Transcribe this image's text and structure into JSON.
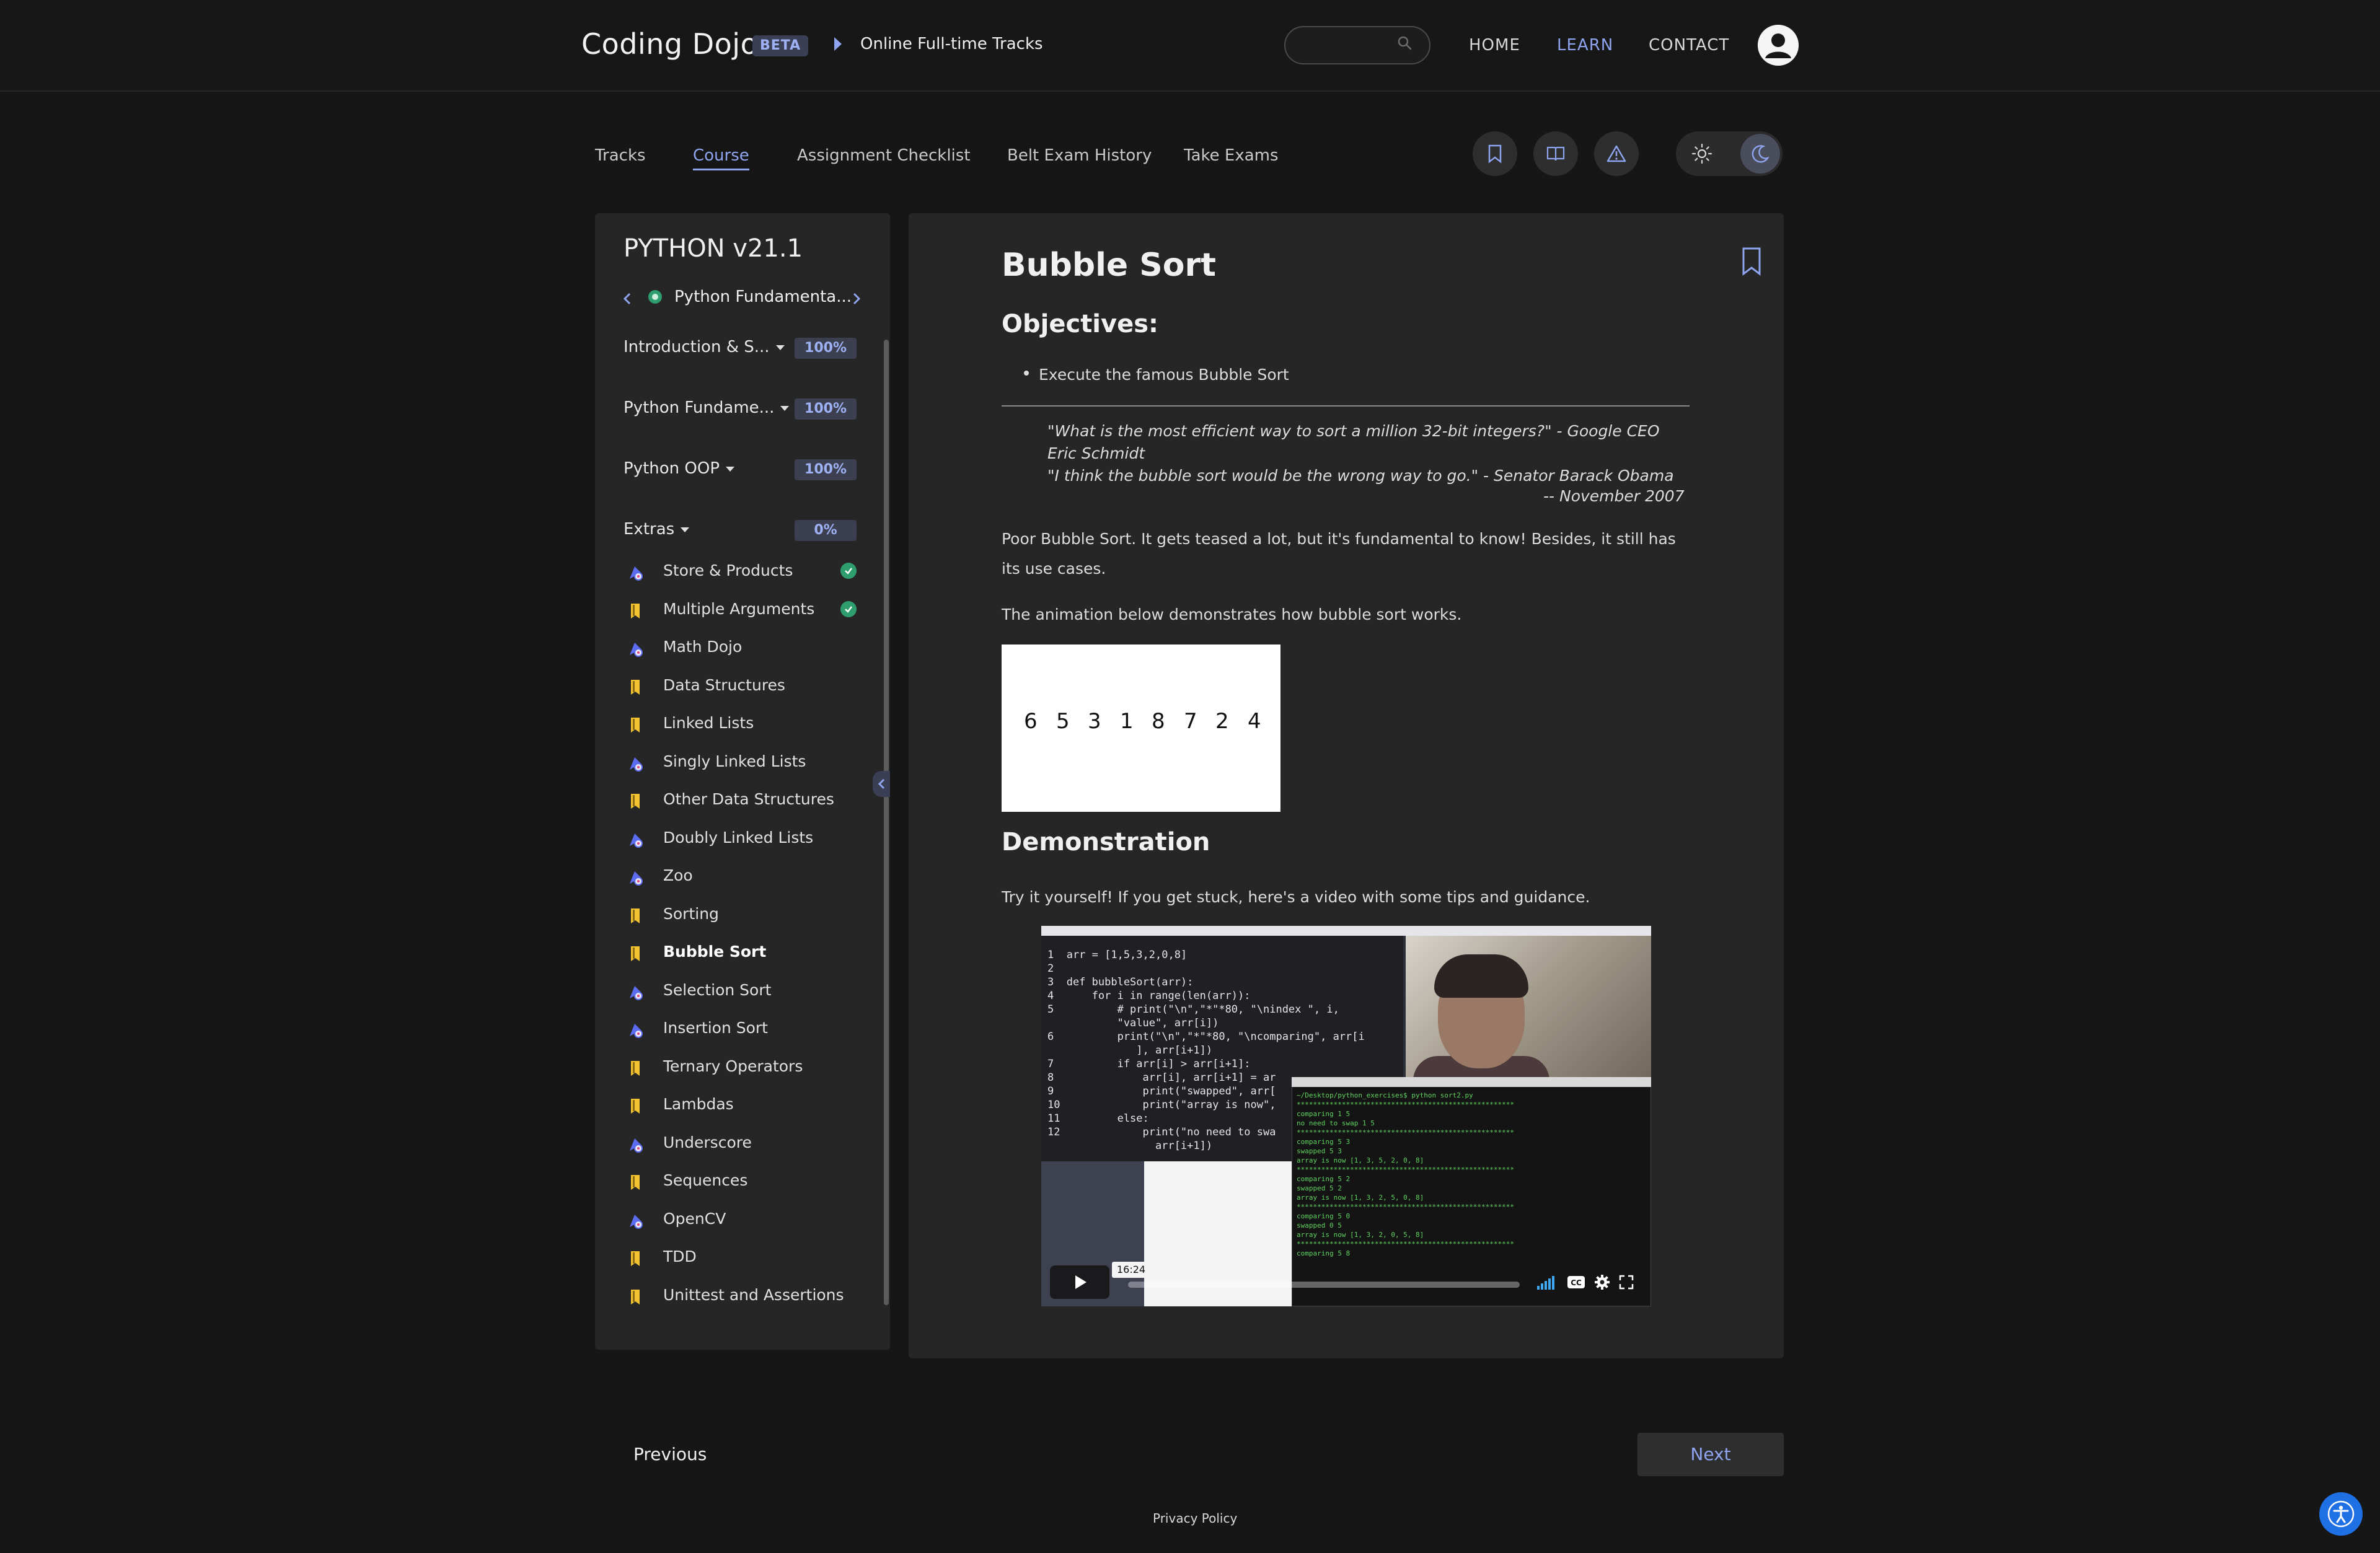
{
  "header": {
    "brand": "Coding Dojo",
    "badge": "BETA",
    "breadcrumb": "Online Full-time Tracks",
    "search_placeholder": "",
    "nav": {
      "home": "HOME",
      "learn": "LEARN",
      "contact": "CONTACT"
    }
  },
  "tabs": [
    {
      "label": "Tracks"
    },
    {
      "label": "Course"
    },
    {
      "label": "Assignment Checklist"
    },
    {
      "label": "Belt Exam History"
    },
    {
      "label": "Take Exams"
    }
  ],
  "sidebar": {
    "title": "PYTHON v21.1",
    "module": "Python Fundamenta...",
    "sections": [
      {
        "label": "Introduction & S...",
        "percent": "100%"
      },
      {
        "label": "Python Fundame...",
        "percent": "100%"
      },
      {
        "label": "Python OOP",
        "percent": "100%"
      },
      {
        "label": "Extras",
        "percent": "0%"
      }
    ],
    "items": [
      {
        "label": "Store & Products",
        "type": "assignment",
        "completed": true
      },
      {
        "label": "Multiple Arguments",
        "type": "reading",
        "completed": true
      },
      {
        "label": "Math Dojo",
        "type": "assignment",
        "completed": false
      },
      {
        "label": "Data Structures",
        "type": "reading",
        "completed": false
      },
      {
        "label": "Linked Lists",
        "type": "reading",
        "completed": false
      },
      {
        "label": "Singly Linked Lists",
        "type": "assignment",
        "completed": false
      },
      {
        "label": "Other Data Structures",
        "type": "reading",
        "completed": false
      },
      {
        "label": "Doubly Linked Lists",
        "type": "assignment",
        "completed": false
      },
      {
        "label": "Zoo",
        "type": "assignment",
        "completed": false
      },
      {
        "label": "Sorting",
        "type": "reading",
        "completed": false
      },
      {
        "label": "Bubble Sort",
        "type": "reading",
        "completed": false
      },
      {
        "label": "Selection Sort",
        "type": "assignment",
        "completed": false
      },
      {
        "label": "Insertion Sort",
        "type": "assignment",
        "completed": false
      },
      {
        "label": "Ternary Operators",
        "type": "reading",
        "completed": false
      },
      {
        "label": "Lambdas",
        "type": "reading",
        "completed": false
      },
      {
        "label": "Underscore",
        "type": "assignment",
        "completed": false
      },
      {
        "label": "Sequences",
        "type": "reading",
        "completed": false
      },
      {
        "label": "OpenCV",
        "type": "assignment",
        "completed": false
      },
      {
        "label": "TDD",
        "type": "reading",
        "completed": false
      },
      {
        "label": "Unittest and Assertions",
        "type": "reading",
        "completed": false
      }
    ]
  },
  "content": {
    "title": "Bubble Sort",
    "objectives_heading": "Objectives:",
    "objectives": [
      "Execute the famous Bubble Sort"
    ],
    "quote_line1": "\"What is the most efficient way to sort a million 32-bit integers?\" - Google CEO Eric Schmidt",
    "quote_line2": "\"I think the bubble sort would be the wrong way to go.\" - Senator Barack Obama",
    "quote_date": "-- November 2007",
    "para1": "Poor Bubble Sort. It gets teased a lot, but it's fundamental to know! Besides, it still has its use cases.",
    "para2": "The animation below demonstrates how bubble sort works.",
    "animation_numbers": [
      "6",
      "5",
      "3",
      "1",
      "8",
      "7",
      "2",
      "4"
    ],
    "demo_heading": "Demonstration",
    "para3": "Try it yourself! If you get stuck, here's a video with some tips and guidance.",
    "video": {
      "timestamp": "16:24",
      "code": "1  arr = [1,5,3,2,0,8]\n2\n3  def bubbleSort(arr):\n4      for i in range(len(arr)):\n5          # print(\"\\n\",\"*\"*80, \"\\nindex \", i,\n           \"value\", arr[i])\n6          print(\"\\n\",\"*\"*80, \"\\ncomparing\", arr[i\n              ], arr[i+1])\n7          if arr[i] > arr[i+1]:\n8              arr[i], arr[i+1] = ar\n9              print(\"swapped\", arr[\n10             print(\"array is now\",\n11         else:\n12             print(\"no need to swa\n                 arr[i+1])",
      "terminal": "~/Desktop/python_exercises$ python sort2.py\n*****************************************************\ncomparing 1 5\nno need to swap 1 5\n*****************************************************\ncomparing 5 3\nswapped 5 3\narray is now [1, 3, 5, 2, 0, 8]\n*****************************************************\ncomparing 5 2\nswapped 5 2\narray is now [1, 3, 2, 5, 0, 8]\n*****************************************************\ncomparing 5 0\nswapped 0 5\narray is now [1, 3, 2, 0, 5, 8]\n*****************************************************\ncomparing 5 8"
    }
  },
  "footer": {
    "previous": "Previous",
    "next": "Next",
    "privacy": "Privacy Policy"
  },
  "colors": {
    "accent": "#8fa4ef",
    "background": "#161616",
    "panel": "#262626",
    "complete": "#2f9e6e",
    "reading_icon": "#f2c230",
    "assignment_icon": "#5b6cf0"
  }
}
